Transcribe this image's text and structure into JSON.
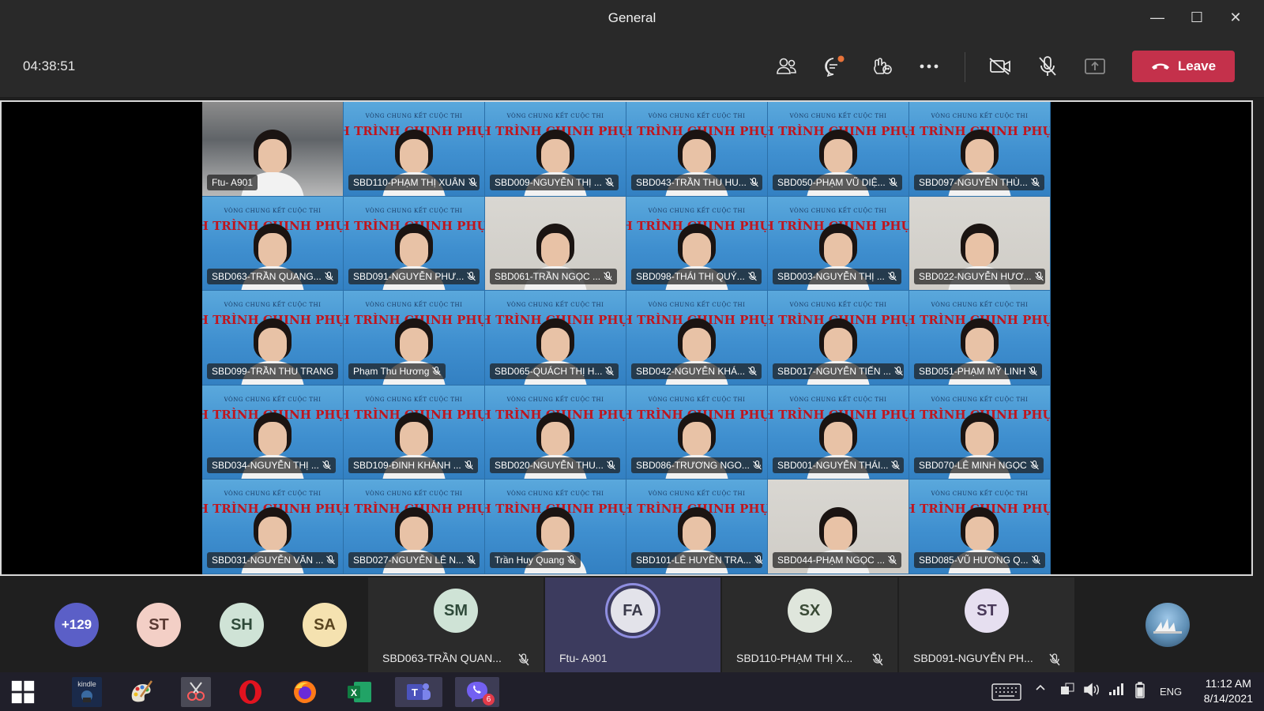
{
  "window": {
    "title": "General",
    "minimize_glyph": "—",
    "maximize_glyph": "☐",
    "close_glyph": "✕"
  },
  "toolbar": {
    "timer": "04:38:51",
    "leave_label": "Leave",
    "icons": [
      "participants-icon",
      "chat-icon",
      "reactions-icon",
      "more-options-icon",
      "camera-off-icon",
      "mic-off-icon",
      "share-tray-icon"
    ],
    "chat_badge_color": "#e8733a",
    "leave_color": "#c4314b"
  },
  "gallery": {
    "banner_line1": "VÒNG CHUNG KẾT CUỘC THI",
    "banner_line2": "NH TRÌNH CHINH PHỤC TRI TH",
    "tiles": [
      {
        "name": "Ftu- A901",
        "style": "room",
        "mic": false
      },
      {
        "name": "SBD110-PHẠM THỊ XUÂN",
        "style": "blue",
        "mic": true
      },
      {
        "name": "SBD009-NGUYỄN THỊ ...",
        "style": "blue",
        "mic": true
      },
      {
        "name": "SBD043-TRẦN THU HU...",
        "style": "blue",
        "mic": true
      },
      {
        "name": "SBD050-PHẠM VŨ DIỆ...",
        "style": "blue",
        "mic": true
      },
      {
        "name": "SBD097-NGUYỄN THÙ...",
        "style": "blue",
        "mic": true
      },
      {
        "name": "SBD063-TRẦN QUANG...",
        "style": "blue",
        "mic": true
      },
      {
        "name": "SBD091-NGUYỄN PHƯ...",
        "style": "blue",
        "mic": true
      },
      {
        "name": "SBD061-TRẦN NGỌC ...",
        "style": "plain",
        "mic": true
      },
      {
        "name": "SBD098-THÁI THỊ QUÝ...",
        "style": "blue",
        "mic": true
      },
      {
        "name": "SBD003-NGUYỄN THỊ ...",
        "style": "blue",
        "mic": true
      },
      {
        "name": "SBD022-NGUYỄN HƯƠ...",
        "style": "plain",
        "mic": true
      },
      {
        "name": "SBD099-TRẦN THU TRANG",
        "style": "blue",
        "mic": false
      },
      {
        "name": "Phạm Thu Hương",
        "style": "blue",
        "mic": true
      },
      {
        "name": "SBD065-QUÁCH THỊ H...",
        "style": "blue",
        "mic": true
      },
      {
        "name": "SBD042-NGUYỄN KHÁ...",
        "style": "blue",
        "mic": true
      },
      {
        "name": "SBD017-NGUYỄN TIẾN ...",
        "style": "blue",
        "mic": true
      },
      {
        "name": "SBD051-PHẠM MỸ LINH",
        "style": "blue",
        "mic": true
      },
      {
        "name": "SBD034-NGUYỄN THỊ ...",
        "style": "blue",
        "mic": true
      },
      {
        "name": "SBD109-ĐINH KHÁNH ...",
        "style": "blue",
        "mic": true
      },
      {
        "name": "SBD020-NGUYỄN THU...",
        "style": "blue",
        "mic": true
      },
      {
        "name": "SBD086-TRƯƠNG NGO...",
        "style": "blue",
        "mic": true
      },
      {
        "name": "SBD001-NGUYỄN THÁI...",
        "style": "blue",
        "mic": true
      },
      {
        "name": "SBD070-LÊ MINH NGỌC",
        "style": "blue",
        "mic": true
      },
      {
        "name": "SBD031-NGUYỄN VĂN ...",
        "style": "blue",
        "mic": true
      },
      {
        "name": "SBD027-NGUYỄN LÊ N...",
        "style": "blue",
        "mic": true
      },
      {
        "name": "Trần Huy Quang",
        "style": "blue",
        "mic": true
      },
      {
        "name": "SBD101-LÊ HUYỀN TRA...",
        "style": "blue",
        "mic": true
      },
      {
        "name": "SBD044-PHẠM NGỌC ...",
        "style": "plain",
        "mic": true
      },
      {
        "name": "SBD085-VŨ HƯƠNG Q...",
        "style": "blue",
        "mic": true
      }
    ]
  },
  "strip": {
    "overflow_count": "+129",
    "avatars": [
      {
        "initials": "ST",
        "bg": "#f3cfc6",
        "fg": "#5a3a33"
      },
      {
        "initials": "SH",
        "bg": "#cfe3d6",
        "fg": "#2f4a3a"
      },
      {
        "initials": "SA",
        "bg": "#f5e2b0",
        "fg": "#5a4520"
      }
    ],
    "cards": [
      {
        "initials": "SM",
        "name": "SBD063-TRẦN QUAN...",
        "bg": "#cfe3d6",
        "fg": "#2f4a3a",
        "muted": true,
        "active": false
      },
      {
        "initials": "FA",
        "name": "Ftu- A901",
        "bg": "#e3e3ea",
        "fg": "#3a3a4a",
        "muted": false,
        "active": true
      },
      {
        "initials": "SX",
        "name": "SBD110-PHẠM THỊ X...",
        "bg": "#dfe6dc",
        "fg": "#3a4a36",
        "muted": true,
        "active": false
      },
      {
        "initials": "ST",
        "name": "SBD091-NGUYỄN PH...",
        "bg": "#e6dff0",
        "fg": "#4a3a5a",
        "muted": true,
        "active": false
      }
    ],
    "overflow_bg": "#5b5fc7"
  },
  "taskbar": {
    "apps": [
      "windows-start-icon",
      "kindle-icon",
      "paint-icon",
      "snip-tool-icon",
      "opera-icon",
      "firefox-icon",
      "excel-icon",
      "teams-icon",
      "viber-icon"
    ],
    "viber_badge": "6",
    "kindle_label": "kindle",
    "language": "ENG",
    "time": "11:12 AM",
    "date": "8/14/2021"
  }
}
